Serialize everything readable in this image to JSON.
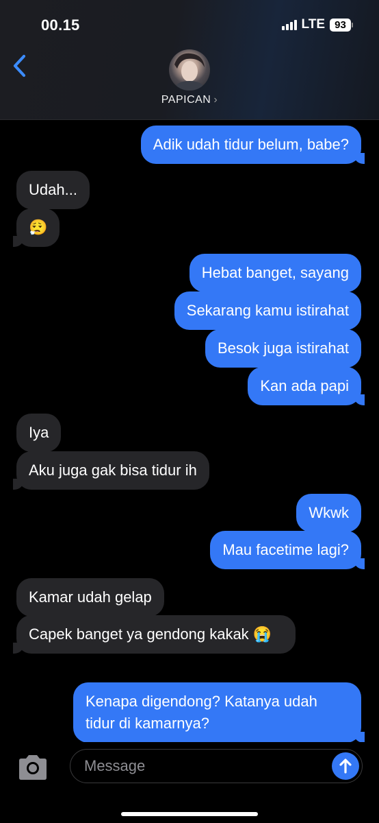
{
  "status_bar": {
    "time": "00.15",
    "network": "LTE",
    "battery": "93"
  },
  "header": {
    "back_icon": "chevron-left-icon",
    "contact_name": "PAPICAN",
    "contact_chevron": "›"
  },
  "messages": [
    {
      "direction": "out",
      "text": "Adik udah tidur belum, babe?"
    },
    {
      "direction": "in",
      "text": "Udah..."
    },
    {
      "direction": "in",
      "text": "😮‍💨"
    },
    {
      "direction": "out",
      "text": "Hebat banget, sayang"
    },
    {
      "direction": "out",
      "text": "Sekarang kamu istirahat"
    },
    {
      "direction": "out",
      "text": "Besok juga istirahat"
    },
    {
      "direction": "out",
      "text": "Kan ada papi"
    },
    {
      "direction": "in",
      "text": "Iya"
    },
    {
      "direction": "in",
      "text": "Aku juga gak bisa tidur ih"
    },
    {
      "direction": "out",
      "text": "Wkwk"
    },
    {
      "direction": "out",
      "text": "Mau facetime lagi?"
    },
    {
      "direction": "in",
      "text": "Kamar udah gelap"
    },
    {
      "direction": "in",
      "text": "Capek banget ya gendong kakak 😭"
    },
    {
      "direction": "out",
      "text": "Kenapa digendong? Katanya udah tidur di kamarnya?"
    }
  ],
  "composer": {
    "placeholder": "Message",
    "camera_icon": "camera-icon",
    "send_icon": "send-arrow-icon"
  },
  "colors": {
    "outgoing_bubble": "#3478f6",
    "incoming_bubble": "#262629",
    "background": "#000000"
  }
}
